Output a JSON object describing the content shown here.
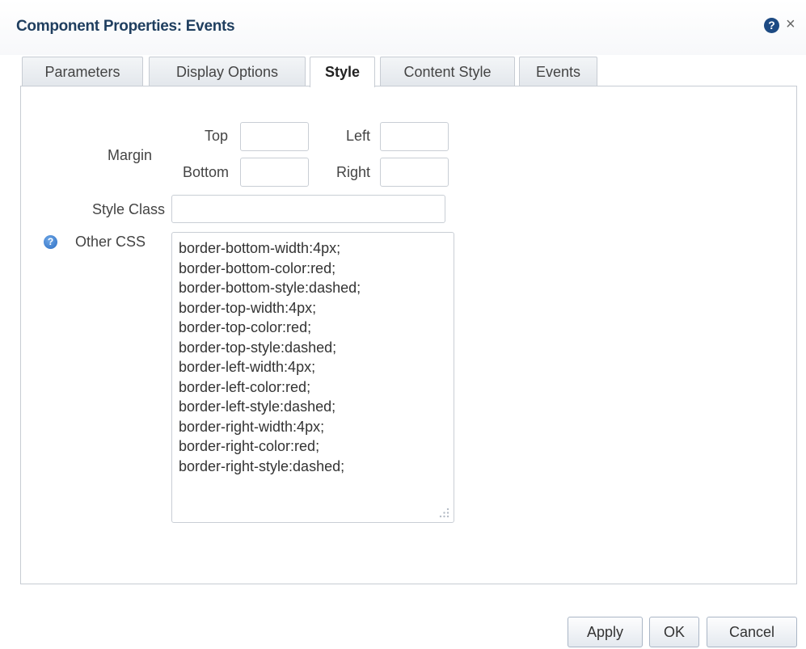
{
  "dialog": {
    "title": "Component Properties: Events",
    "help_icon": "question-mark-icon",
    "close_symbol": "×"
  },
  "tabs": [
    {
      "label": "Parameters",
      "active": false
    },
    {
      "label": "Display Options",
      "active": false
    },
    {
      "label": "Style",
      "active": true
    },
    {
      "label": "Content Style",
      "active": false
    },
    {
      "label": "Events",
      "active": false
    }
  ],
  "form": {
    "margin_label": "Margin",
    "top_label": "Top",
    "left_label": "Left",
    "bottom_label": "Bottom",
    "right_label": "Right",
    "top_value": "",
    "left_value": "",
    "bottom_value": "",
    "right_value": "",
    "style_class_label": "Style Class",
    "style_class_value": "",
    "other_css_label": "Other CSS",
    "other_css_lines": [
      "border-bottom-width:4px;",
      "border-bottom-color:red;",
      "border-bottom-style:dashed;",
      "border-top-width:4px;",
      "border-top-color:red;",
      "border-top-style:dashed;",
      "border-left-width:4px;",
      "border-left-color:red;",
      "border-left-style:dashed;",
      "border-right-width:4px;",
      "border-right-color:red;",
      "border-right-style:dashed;"
    ]
  },
  "buttons": {
    "apply": "Apply",
    "ok": "OK",
    "cancel": "Cancel"
  },
  "colors": {
    "title": "#1f3e5f",
    "help_icon_bg": "#1d4a83",
    "info_icon_bg": "#2c6ec4",
    "border": "#c7ccd3"
  }
}
